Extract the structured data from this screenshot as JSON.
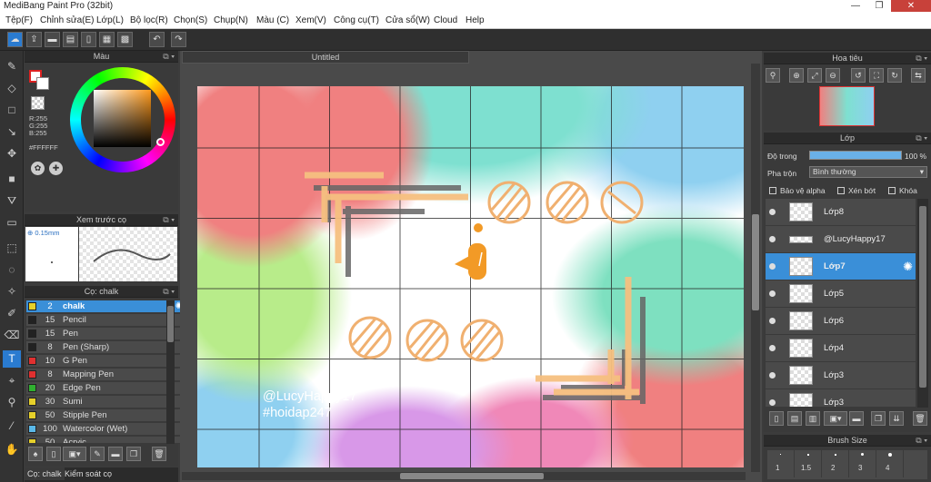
{
  "app": {
    "title": "MediBang Paint Pro (32bit)",
    "win_min": "—",
    "win_max": "❐",
    "win_close": "✕"
  },
  "menu": [
    "Tệp(F)",
    "Chỉnh sửa(E)",
    "Lớp(L)",
    "Bộ lọc(R)",
    "Chọn(S)",
    "Chụp(N)",
    "Màu (C)",
    "Xem(V)",
    "Công cụ(T)",
    "Cửa sổ(W)",
    "Cloud",
    "Help"
  ],
  "color_panel": {
    "title": "Màu",
    "rgb": [
      "R:255",
      "G:255",
      "B:255"
    ],
    "hex": "#FFFFFF"
  },
  "preview_panel": {
    "title": "Xem trước cọ",
    "size": "0.15mm"
  },
  "brush_panel": {
    "title": "Cọ: chalk",
    "items": [
      {
        "size": "2",
        "name": "chalk",
        "color": "#e6d02a"
      },
      {
        "size": "15",
        "name": "Pencil",
        "color": "#222222"
      },
      {
        "size": "15",
        "name": "Pen",
        "color": "#222222"
      },
      {
        "size": "8",
        "name": "Pen (Sharp)",
        "color": "#222222"
      },
      {
        "size": "10",
        "name": "G Pen",
        "color": "#e03030"
      },
      {
        "size": "8",
        "name": "Mapping Pen",
        "color": "#e03030"
      },
      {
        "size": "20",
        "name": "Edge Pen",
        "color": "#30b030"
      },
      {
        "size": "30",
        "name": "Sumi",
        "color": "#e6d02a"
      },
      {
        "size": "50",
        "name": "Stipple Pen",
        "color": "#e6d02a"
      },
      {
        "size": "100",
        "name": "Watercolor (Wet)",
        "color": "#5ab8e8"
      },
      {
        "size": "50",
        "name": "Acryic",
        "color": "#e6d02a"
      }
    ]
  },
  "bottom_tabs": [
    "Cọ: chalk",
    "Kiểm soát cọ"
  ],
  "canvas": {
    "tab": "Untitled",
    "watermark": [
      "@LucyHappy17",
      "#hoidap247"
    ]
  },
  "navigator": {
    "title": "Hoa tiêu"
  },
  "layer_panel": {
    "title": "Lớp",
    "opacity_label": "Độ trong",
    "opacity_value": "100 %",
    "blend_label": "Pha trộn",
    "blend_value": "Bình thường",
    "checks": [
      "Bảo vệ alpha",
      "Xén bớt",
      "Khóa"
    ],
    "layers": [
      "Lớp8",
      "@LucyHappy17",
      "Lớp7",
      "Lớp5",
      "Lớp6",
      "Lớp4",
      "Lớp3",
      "Lớp3"
    ]
  },
  "brush_size": {
    "title": "Brush Size",
    "values": [
      "1",
      "1.5",
      "2",
      "3",
      "4"
    ]
  },
  "colors": {
    "accent": "#3a8fd8",
    "panel": "#3a3a3a"
  }
}
